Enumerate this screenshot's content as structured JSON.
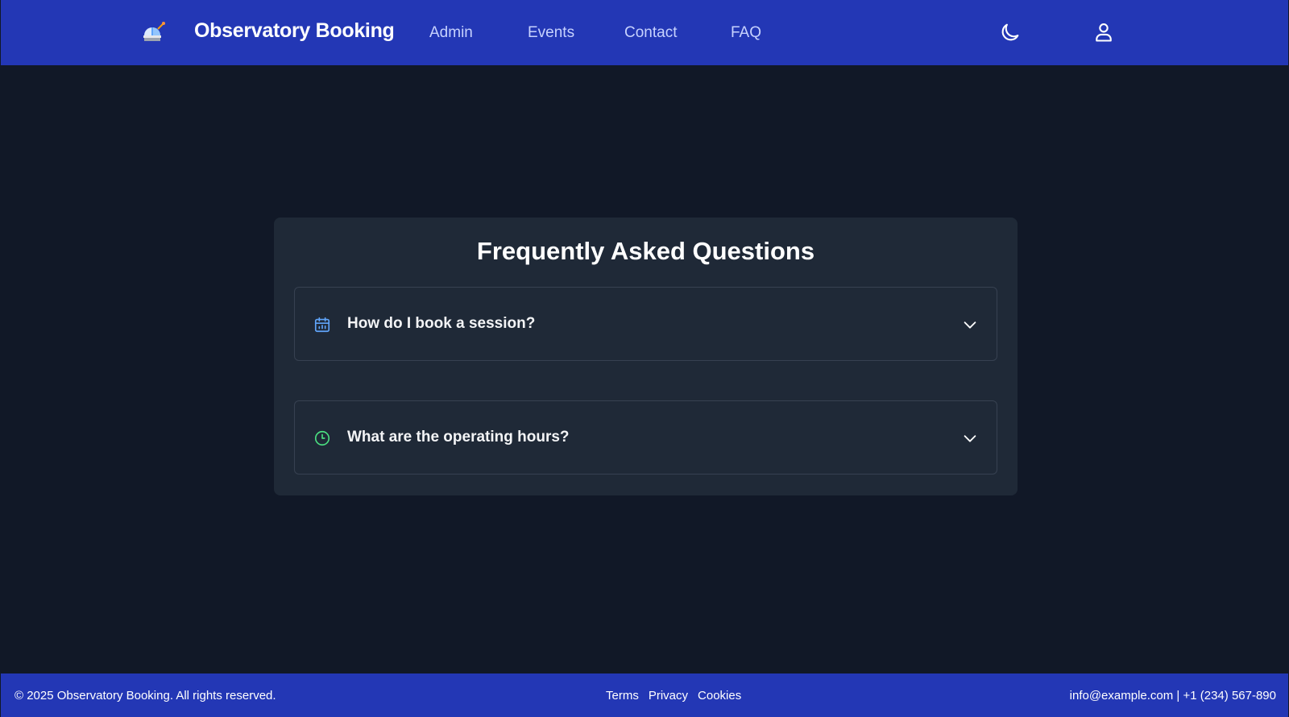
{
  "header": {
    "brand": "Observatory Booking",
    "nav": {
      "admin": "Admin",
      "events": "Events",
      "contact": "Contact",
      "faq": "FAQ"
    },
    "icons": {
      "logo": "observatory-icon",
      "theme": "moon-icon",
      "user": "user-icon"
    }
  },
  "faq": {
    "title": "Frequently Asked Questions",
    "items": [
      {
        "question": "How do I book a session?",
        "icon": "calendar-icon"
      },
      {
        "question": "What are the operating hours?",
        "icon": "clock-icon"
      }
    ]
  },
  "footer": {
    "copyright": "© 2025 Observatory Booking. All rights reserved.",
    "links": [
      "Terms",
      "Privacy",
      "Cookies"
    ],
    "contact": "info@example.com | +1 (234) 567-890"
  },
  "colors": {
    "header_bg": "#2337b5",
    "page_bg": "#111827",
    "card_bg": "#1f2937",
    "calendar_icon": "#60a5fa",
    "clock_icon": "#4ade80"
  }
}
